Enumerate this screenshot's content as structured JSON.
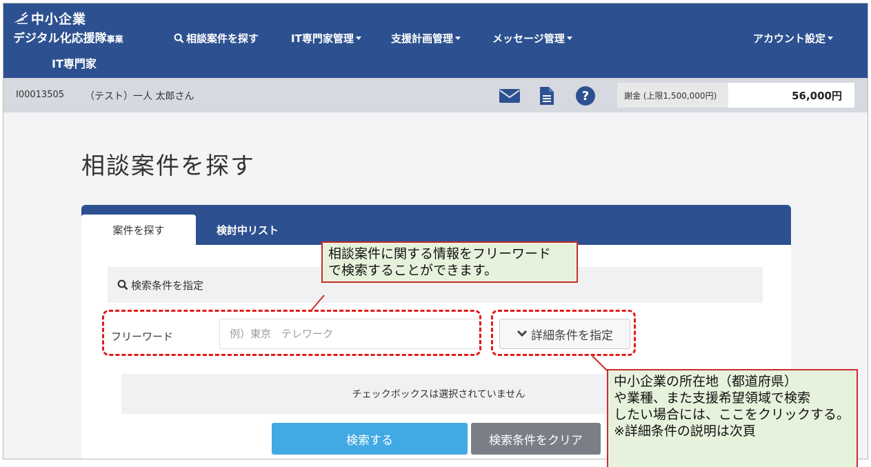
{
  "header": {
    "logo_line1": "中小企業",
    "logo_line2": "デジタル化応援隊",
    "logo_line2_small": "事業",
    "portal_label": "IT専門家",
    "nav": {
      "search": "相談案件を探す",
      "experts": "IT専門家管理",
      "plans": "支援計画管理",
      "messages": "メッセージ管理",
      "account": "アカウント設定"
    }
  },
  "subbar": {
    "user_id": "I00013505",
    "user_name": "（テスト）一人 太郎さん",
    "fee_label": "謝金 (上限1,500,000円)",
    "fee_value": "56,000円"
  },
  "page": {
    "title": "相談案件を探す",
    "tabs": [
      "案件を探す",
      "検討中リスト"
    ],
    "search_conditions": "検索条件を指定",
    "freeword_label": "フリーワード",
    "freeword_placeholder": "例）東京　テレワーク",
    "freeword_value": "",
    "detail_button": "詳細条件を指定",
    "status_text": "チェックボックスは選択されていません",
    "search_button": "検索する",
    "clear_button": "検索条件をクリア"
  },
  "annotations": {
    "note1_line1": "相談案件に関する情報をフリーワード",
    "note1_line2": "で検索することができます。",
    "note2_line1": "中小企業の所在地（都道府県）",
    "note2_line2": "や業種、また支援希望領域で検索",
    "note2_line3": "したい場合には、ここをクリックする。",
    "note2_line4": "※詳細条件の説明は次頁"
  },
  "colors": {
    "header_bg": "#2d5190",
    "subbar_bg": "#d6d9e0",
    "search_button": "#41a9e3",
    "clear_button": "#7a7f87",
    "annotation_border": "#e01a1a",
    "annotation_bg": "#e7f2dc"
  },
  "icons": {
    "mail": "envelope-icon",
    "document": "document-icon",
    "help": "question-circle-icon",
    "search": "magnifier-icon",
    "detail": "chevron-down-icon"
  }
}
